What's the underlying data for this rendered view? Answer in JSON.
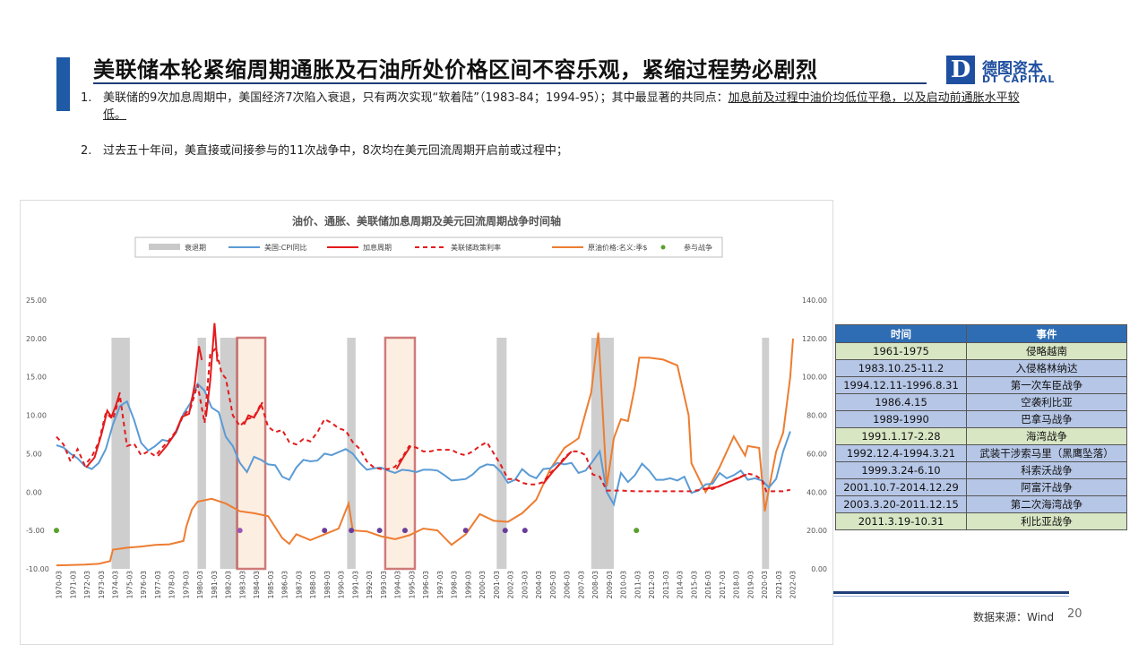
{
  "title": "美联储本轮紧缩周期通胀及石油所处价格区间不容乐观，紧缩过程势必剧烈",
  "logo": {
    "cn": "德图资本",
    "en": "DT CAPITAL",
    "mark": "D"
  },
  "bullets": [
    {
      "num": "1.",
      "text": "美联储的9次加息周期中，美国经济7次陷入衰退，只有两次实现“软着陆”（1983-84；1994-95）；其中最显著的共同点：",
      "underline": "加息前及过程中油价均低位平稳，以及启动前通胀水平较低。"
    },
    {
      "num": "2.",
      "text": "过去五十年间，美直接或间接参与的11次战争中，8次均在美元回流周期开启前或过程中；"
    }
  ],
  "chart_data": {
    "type": "line",
    "title": "油价、通胀、美联储加息周期及美元回流周期战争时间轴",
    "legend": [
      "衰退期",
      "美国:CPI同比",
      "加息周期",
      "美联储政策利率",
      "原油价格:名义:季$",
      "参与战争"
    ],
    "left_axis": {
      "min": -10,
      "max": 25,
      "ticks": [
        "25.00",
        "20.00",
        "15.00",
        "10.00",
        "5.00",
        "0.00",
        "-5.00",
        "-10.00"
      ]
    },
    "right_axis": {
      "min": 0,
      "max": 140,
      "ticks": [
        "140.00",
        "120.00",
        "100.00",
        "80.00",
        "60.00",
        "40.00",
        "20.00",
        "0.00"
      ]
    },
    "x_labels": [
      "1970-03",
      "1971-03",
      "1972-03",
      "1973-03",
      "1974-03",
      "1975-03",
      "1976-03",
      "1977-03",
      "1978-03",
      "1979-03",
      "1980-03",
      "1981-03",
      "1982-03",
      "1983-03",
      "1984-03",
      "1985-03",
      "1986-03",
      "1987-03",
      "1988-03",
      "1989-03",
      "1990-03",
      "1991-03",
      "1992-03",
      "1993-03",
      "1994-03",
      "1995-03",
      "1996-03",
      "1997-03",
      "1998-03",
      "1999-03",
      "2000-03",
      "2001-03",
      "2002-03",
      "2003-03",
      "2004-03",
      "2005-03",
      "2006-03",
      "2007-03",
      "2008-03",
      "2009-03",
      "2010-03",
      "2011-03",
      "2012-03",
      "2013-03",
      "2014-03",
      "2015-03",
      "2016-03",
      "2017-03",
      "2018-03",
      "2019-03",
      "2020-03",
      "2021-03",
      "2022-03"
    ],
    "recessions": [
      [
        1973.9,
        1975.2
      ],
      [
        1980.0,
        1980.6
      ],
      [
        1981.6,
        1982.9
      ],
      [
        1990.6,
        1991.2
      ],
      [
        2001.2,
        2001.9
      ],
      [
        2007.9,
        2009.5
      ],
      [
        2020.0,
        2020.5
      ]
    ],
    "soft_landing_boxes": [
      [
        1982.8,
        1984.8
      ],
      [
        1993.3,
        1995.4
      ]
    ],
    "cpi": [
      [
        1970,
        6.1
      ],
      [
        1970.5,
        5.8
      ],
      [
        1971,
        5.0
      ],
      [
        1971.5,
        4.4
      ],
      [
        1972,
        3.4
      ],
      [
        1972.5,
        3.0
      ],
      [
        1973,
        3.8
      ],
      [
        1973.5,
        5.6
      ],
      [
        1974,
        8.8
      ],
      [
        1974.5,
        11.2
      ],
      [
        1975,
        11.8
      ],
      [
        1975.5,
        9.4
      ],
      [
        1976,
        6.4
      ],
      [
        1976.5,
        5.4
      ],
      [
        1977,
        6.0
      ],
      [
        1977.5,
        6.8
      ],
      [
        1978,
        6.6
      ],
      [
        1978.5,
        7.8
      ],
      [
        1979,
        10.2
      ],
      [
        1979.5,
        11.6
      ],
      [
        1980,
        14.1
      ],
      [
        1980.5,
        13.2
      ],
      [
        1981,
        11.0
      ],
      [
        1981.5,
        10.4
      ],
      [
        1982,
        7.2
      ],
      [
        1982.5,
        6.0
      ],
      [
        1983,
        3.8
      ],
      [
        1983.5,
        2.6
      ],
      [
        1984,
        4.6
      ],
      [
        1984.5,
        4.2
      ],
      [
        1985,
        3.6
      ],
      [
        1985.5,
        3.5
      ],
      [
        1986,
        2.0
      ],
      [
        1986.5,
        1.6
      ],
      [
        1987,
        3.2
      ],
      [
        1987.5,
        4.2
      ],
      [
        1988,
        4.0
      ],
      [
        1988.5,
        4.1
      ],
      [
        1989,
        5.0
      ],
      [
        1989.5,
        4.8
      ],
      [
        1990,
        5.2
      ],
      [
        1990.5,
        5.6
      ],
      [
        1991,
        5.0
      ],
      [
        1991.5,
        3.8
      ],
      [
        1992,
        2.9
      ],
      [
        1992.5,
        3.1
      ],
      [
        1993,
        3.2
      ],
      [
        1993.5,
        2.8
      ],
      [
        1994,
        2.5
      ],
      [
        1994.5,
        2.9
      ],
      [
        1995,
        2.8
      ],
      [
        1995.5,
        2.6
      ],
      [
        1996,
        2.9
      ],
      [
        1996.5,
        2.9
      ],
      [
        1997,
        2.8
      ],
      [
        1997.5,
        2.2
      ],
      [
        1998,
        1.5
      ],
      [
        1998.5,
        1.6
      ],
      [
        1999,
        1.7
      ],
      [
        1999.5,
        2.3
      ],
      [
        2000,
        3.2
      ],
      [
        2000.5,
        3.6
      ],
      [
        2001,
        3.5
      ],
      [
        2001.5,
        2.6
      ],
      [
        2002,
        1.2
      ],
      [
        2002.5,
        1.6
      ],
      [
        2003,
        3.0
      ],
      [
        2003.5,
        2.2
      ],
      [
        2004,
        1.8
      ],
      [
        2004.5,
        3.0
      ],
      [
        2005,
        3.1
      ],
      [
        2005.5,
        3.8
      ],
      [
        2006,
        3.6
      ],
      [
        2006.5,
        3.8
      ],
      [
        2007,
        2.5
      ],
      [
        2007.5,
        2.8
      ],
      [
        2008,
        4.0
      ],
      [
        2008.5,
        5.3
      ],
      [
        2009,
        0.0
      ],
      [
        2009.5,
        -1.6
      ],
      [
        2010,
        2.5
      ],
      [
        2010.5,
        1.3
      ],
      [
        2011,
        2.2
      ],
      [
        2011.5,
        3.7
      ],
      [
        2012,
        2.8
      ],
      [
        2012.5,
        1.6
      ],
      [
        2013,
        1.6
      ],
      [
        2013.5,
        1.8
      ],
      [
        2014,
        1.5
      ],
      [
        2014.5,
        2.0
      ],
      [
        2015,
        -0.1
      ],
      [
        2015.5,
        0.2
      ],
      [
        2016,
        1.0
      ],
      [
        2016.5,
        1.1
      ],
      [
        2017,
        2.5
      ],
      [
        2017.5,
        1.8
      ],
      [
        2018,
        2.2
      ],
      [
        2018.5,
        2.8
      ],
      [
        2019,
        1.6
      ],
      [
        2019.5,
        1.8
      ],
      [
        2020,
        1.5
      ],
      [
        2020.5,
        0.6
      ],
      [
        2021,
        1.7
      ],
      [
        2021.5,
        5.3
      ],
      [
        2022,
        7.9
      ]
    ],
    "hike_periods": [
      [
        [
          1972.1,
          3.2
        ],
        [
          1972.7,
          4.5
        ],
        [
          1973.2,
          7.6
        ],
        [
          1973.6,
          10.6
        ],
        [
          1973.9,
          9.8
        ],
        [
          1974.2,
          11.2
        ],
        [
          1974.5,
          13.0
        ]
      ],
      [
        [
          1977.2,
          4.7
        ],
        [
          1977.8,
          6.0
        ],
        [
          1978.4,
          7.6
        ],
        [
          1978.9,
          9.8
        ],
        [
          1979.4,
          10.2
        ],
        [
          1979.8,
          14.0
        ],
        [
          1980.1,
          19.0
        ],
        [
          1980.3,
          17.2
        ]
      ],
      [
        [
          1980.6,
          9.8
        ],
        [
          1980.9,
          14.5
        ],
        [
          1981.2,
          22.0
        ],
        [
          1981.4,
          17.0
        ]
      ],
      [
        [
          1983.3,
          8.8
        ],
        [
          1983.6,
          10.0
        ],
        [
          1984.0,
          9.7
        ],
        [
          1984.4,
          11.0
        ],
        [
          1984.6,
          11.7
        ]
      ],
      [
        [
          1994.1,
          3.0
        ],
        [
          1994.6,
          4.6
        ],
        [
          1995.1,
          6.0
        ]
      ],
      [
        [
          2004.5,
          1.1
        ],
        [
          2005.2,
          2.7
        ],
        [
          2005.8,
          3.9
        ],
        [
          2006.5,
          5.3
        ]
      ],
      [
        [
          2015.9,
          0.4
        ],
        [
          2016.9,
          0.7
        ],
        [
          2017.5,
          1.2
        ],
        [
          2018.2,
          1.7
        ],
        [
          2018.9,
          2.3
        ]
      ]
    ],
    "policy_rate": [
      [
        1970,
        7.2
      ],
      [
        1970.5,
        6.2
      ],
      [
        1971,
        4.0
      ],
      [
        1971.5,
        5.6
      ],
      [
        1972,
        3.5
      ],
      [
        1972.5,
        4.6
      ],
      [
        1973,
        6.5
      ],
      [
        1973.5,
        10.3
      ],
      [
        1974,
        9.5
      ],
      [
        1974.5,
        12.5
      ],
      [
        1975,
        6.0
      ],
      [
        1975.5,
        6.3
      ],
      [
        1976,
        4.8
      ],
      [
        1976.5,
        5.3
      ],
      [
        1977,
        4.7
      ],
      [
        1977.5,
        5.8
      ],
      [
        1978,
        6.8
      ],
      [
        1978.5,
        8.0
      ],
      [
        1979,
        10.0
      ],
      [
        1979.5,
        10.9
      ],
      [
        1980,
        14.0
      ],
      [
        1980.5,
        9.0
      ],
      [
        1980.9,
        18.0
      ],
      [
        1981.3,
        18.7
      ],
      [
        1981.7,
        15.5
      ],
      [
        1982,
        14.8
      ],
      [
        1982.5,
        10.0
      ],
      [
        1983,
        8.6
      ],
      [
        1983.5,
        9.5
      ],
      [
        1984,
        9.8
      ],
      [
        1984.5,
        11.5
      ],
      [
        1985,
        8.5
      ],
      [
        1985.5,
        7.8
      ],
      [
        1986,
        8.1
      ],
      [
        1986.5,
        6.5
      ],
      [
        1987,
        6.2
      ],
      [
        1987.5,
        6.9
      ],
      [
        1988,
        6.6
      ],
      [
        1988.5,
        7.8
      ],
      [
        1989,
        9.5
      ],
      [
        1989.5,
        9.0
      ],
      [
        1990,
        8.3
      ],
      [
        1990.5,
        8.0
      ],
      [
        1991,
        6.5
      ],
      [
        1991.5,
        5.6
      ],
      [
        1992,
        4.0
      ],
      [
        1992.5,
        3.2
      ],
      [
        1993,
        3.0
      ],
      [
        1993.5,
        3.0
      ],
      [
        1994,
        3.3
      ],
      [
        1994.5,
        4.5
      ],
      [
        1995,
        6.0
      ],
      [
        1995.5,
        5.8
      ],
      [
        1996,
        5.3
      ],
      [
        1996.5,
        5.3
      ],
      [
        1997,
        5.5
      ],
      [
        1997.5,
        5.5
      ],
      [
        1998,
        5.5
      ],
      [
        1998.5,
        5.0
      ],
      [
        1999,
        4.8
      ],
      [
        1999.5,
        5.3
      ],
      [
        2000,
        6.0
      ],
      [
        2000.5,
        6.5
      ],
      [
        2001,
        5.0
      ],
      [
        2001.5,
        3.5
      ],
      [
        2002,
        1.7
      ],
      [
        2002.5,
        1.7
      ],
      [
        2003,
        1.2
      ],
      [
        2003.5,
        1.0
      ],
      [
        2004,
        1.0
      ],
      [
        2004.5,
        1.3
      ],
      [
        2005,
        2.5
      ],
      [
        2005.5,
        3.3
      ],
      [
        2006,
        4.5
      ],
      [
        2006.5,
        5.3
      ],
      [
        2007,
        5.3
      ],
      [
        2007.5,
        4.8
      ],
      [
        2008,
        2.3
      ],
      [
        2008.5,
        2.0
      ],
      [
        2009,
        0.2
      ],
      [
        2010,
        0.2
      ],
      [
        2011,
        0.1
      ],
      [
        2012,
        0.1
      ],
      [
        2013,
        0.1
      ],
      [
        2014,
        0.1
      ],
      [
        2015,
        0.1
      ],
      [
        2015.9,
        0.4
      ],
      [
        2016.5,
        0.4
      ],
      [
        2017,
        0.8
      ],
      [
        2017.5,
        1.2
      ],
      [
        2018,
        1.6
      ],
      [
        2018.5,
        2.0
      ],
      [
        2019,
        2.4
      ],
      [
        2019.5,
        2.2
      ],
      [
        2020,
        1.6
      ],
      [
        2020.3,
        0.1
      ],
      [
        2021,
        0.1
      ],
      [
        2021.5,
        0.1
      ],
      [
        2022,
        0.3
      ]
    ],
    "oil": [
      [
        1970,
        1.8
      ],
      [
        1971,
        2.0
      ],
      [
        1972,
        2.2
      ],
      [
        1973,
        2.6
      ],
      [
        1973.8,
        4.0
      ],
      [
        1974,
        10.0
      ],
      [
        1975,
        11.0
      ],
      [
        1976,
        11.6
      ],
      [
        1977,
        12.5
      ],
      [
        1978,
        12.8
      ],
      [
        1979,
        14.5
      ],
      [
        1979.2,
        22.0
      ],
      [
        1979.6,
        31.0
      ],
      [
        1980,
        35.0
      ],
      [
        1981,
        36.5
      ],
      [
        1982,
        34.0
      ],
      [
        1983,
        30.0
      ],
      [
        1984,
        29.0
      ],
      [
        1985,
        27.5
      ],
      [
        1986,
        16.0
      ],
      [
        1986.5,
        13.0
      ],
      [
        1987,
        18.0
      ],
      [
        1988,
        15.0
      ],
      [
        1989,
        18.0
      ],
      [
        1990,
        21.0
      ],
      [
        1990.7,
        34.0
      ],
      [
        1991,
        20.0
      ],
      [
        1992,
        19.5
      ],
      [
        1993,
        17.0
      ],
      [
        1994,
        15.5
      ],
      [
        1995,
        17.5
      ],
      [
        1996,
        21.0
      ],
      [
        1997,
        20.0
      ],
      [
        1998,
        12.5
      ],
      [
        1999,
        18.0
      ],
      [
        2000,
        28.5
      ],
      [
        2001,
        25.0
      ],
      [
        2002,
        24.5
      ],
      [
        2003,
        29.0
      ],
      [
        2004,
        36.0
      ],
      [
        2005,
        52.0
      ],
      [
        2006,
        63.0
      ],
      [
        2007,
        68.0
      ],
      [
        2007.9,
        92.0
      ],
      [
        2008.4,
        123.0
      ],
      [
        2008.8,
        70.0
      ],
      [
        2009,
        43.0
      ],
      [
        2009.5,
        68.0
      ],
      [
        2010,
        78.0
      ],
      [
        2010.5,
        77.0
      ],
      [
        2011,
        95.0
      ],
      [
        2011.3,
        110.0
      ],
      [
        2012,
        110.0
      ],
      [
        2013,
        109.0
      ],
      [
        2014,
        106.0
      ],
      [
        2014.8,
        80.0
      ],
      [
        2015,
        55.0
      ],
      [
        2016,
        40.0
      ],
      [
        2016.5,
        46.0
      ],
      [
        2017,
        53.0
      ],
      [
        2018,
        69.0
      ],
      [
        2018.8,
        59.0
      ],
      [
        2019,
        64.0
      ],
      [
        2019.8,
        63.0
      ],
      [
        2020.2,
        30.0
      ],
      [
        2020.5,
        42.0
      ],
      [
        2021,
        61.0
      ],
      [
        2021.5,
        71.0
      ],
      [
        2022,
        100.0
      ],
      [
        2022.2,
        120.0
      ]
    ],
    "wars": [
      [
        1970,
        "#5aa02c"
      ],
      [
        1983,
        "#9b59b6"
      ],
      [
        1989,
        "#6a3d9a"
      ],
      [
        1990.9,
        "#6a3d9a"
      ],
      [
        1992.9,
        "#6a3d9a"
      ],
      [
        1994.7,
        "#6a3d9a"
      ],
      [
        1999,
        "#6a3d9a"
      ],
      [
        2001.8,
        "#6a3d9a"
      ],
      [
        2003.2,
        "#6a3d9a"
      ],
      [
        2011.1,
        "#5aa02c"
      ]
    ],
    "colors": {
      "cpi": "#5b9bd5",
      "hike": "#e31a1c",
      "policy": "#e31a1c",
      "oil": "#ed7d31",
      "recession": "#c9c9c9",
      "box_edge": "#c0504d",
      "box_fill": "#fde9d9",
      "war": "#5aa02c"
    }
  },
  "table": {
    "headers": [
      "时间",
      "事件"
    ],
    "rows": [
      [
        "1961-1975",
        "侵略越南"
      ],
      [
        "1983.10.25-11.2",
        "入侵格林纳达"
      ],
      [
        "1994.12.11-1996.8.31",
        "第一次车臣战争"
      ],
      [
        "1986.4.15",
        "空袭利比亚"
      ],
      [
        "1989-1990",
        "巴拿马战争"
      ],
      [
        "1991.1.17-2.28",
        "海湾战争"
      ],
      [
        "1992.12.4-1994.3.21",
        "武装干涉索马里（黑鹰坠落）"
      ],
      [
        "1999.3.24-6.10",
        "科索沃战争"
      ],
      [
        "2001.10.7-2014.12.29",
        "阿富汗战争"
      ],
      [
        "2003.3.20-2011.12.15",
        "第二次海湾战争"
      ],
      [
        "2011.3.19-10.31",
        "利比亚战争"
      ]
    ]
  },
  "source": "数据来源：Wind",
  "page_number": "20"
}
